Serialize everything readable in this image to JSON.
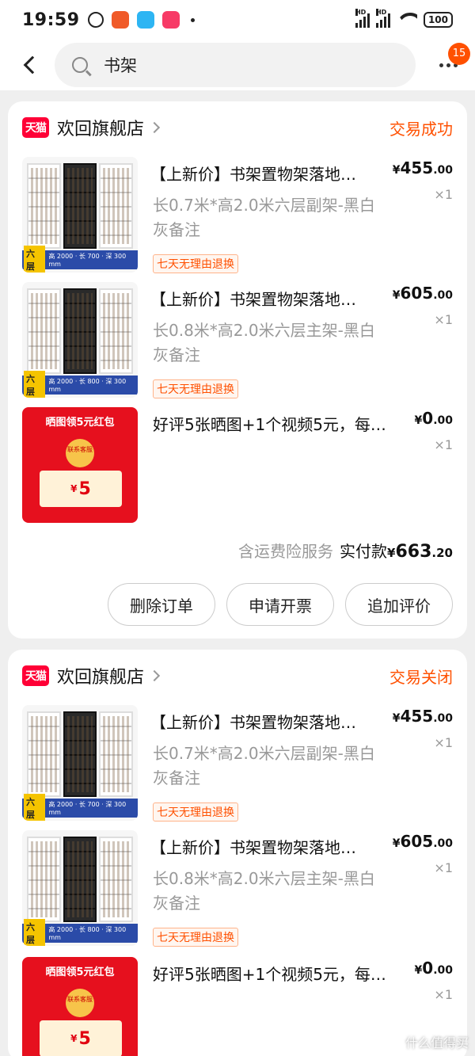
{
  "status_bar": {
    "time": "19:59",
    "battery": "100",
    "signal_label": "HD"
  },
  "nav": {
    "search_text": "书架",
    "message_count": "15"
  },
  "orders": [
    {
      "shop_logo": "天猫",
      "shop_name": "欢回旗舰店",
      "status": "交易成功",
      "items": [
        {
          "title": "【上新价】书架置物架落地…",
          "spec": "长0.7米*高2.0米六层副架-黑白灰备注",
          "tag": "七天无理由退换",
          "price_int": "455",
          "price_dec": ".00",
          "qty": "×1",
          "thumb_level": "六层",
          "thumb_dims": "高 2000 · 长 700 · 深 300 mm"
        },
        {
          "title": "【上新价】书架置物架落地…",
          "spec": "长0.8米*高2.0米六层主架-黑白灰备注",
          "tag": "七天无理由退换",
          "price_int": "605",
          "price_dec": ".00",
          "qty": "×1",
          "thumb_level": "六层",
          "thumb_dims": "高 2000 · 长 800 · 深 300 mm"
        },
        {
          "title": "好评5张晒图+1个视频5元，每…",
          "price_int": "0",
          "price_dec": ".00",
          "qty": "×1",
          "promo_title": "晒图领5元红包",
          "promo_contact": "联系客服",
          "promo_amount": "5"
        }
      ],
      "summary": {
        "shipping_note": "含运费险服务",
        "paid_label": "实付款",
        "paid_int": "663",
        "paid_dec": ".20"
      },
      "actions": [
        "删除订单",
        "申请开票",
        "追加评价"
      ]
    },
    {
      "shop_logo": "天猫",
      "shop_name": "欢回旗舰店",
      "status": "交易关闭",
      "items": [
        {
          "title": "【上新价】书架置物架落地…",
          "spec": "长0.7米*高2.0米六层副架-黑白灰备注",
          "tag": "七天无理由退换",
          "price_int": "455",
          "price_dec": ".00",
          "qty": "×1",
          "thumb_level": "六层",
          "thumb_dims": "高 2000 · 长 700 · 深 300 mm"
        },
        {
          "title": "【上新价】书架置物架落地…",
          "spec": "长0.8米*高2.0米六层主架-黑白灰备注",
          "tag": "七天无理由退换",
          "price_int": "605",
          "price_dec": ".00",
          "qty": "×1",
          "thumb_level": "六层",
          "thumb_dims": "高 2000 · 长 800 · 深 300 mm"
        },
        {
          "title": "好评5张晒图+1个视频5元，每…",
          "price_int": "0",
          "price_dec": ".00",
          "qty": "×1",
          "promo_title": "晒图领5元红包",
          "promo_contact": "联系客服",
          "promo_amount": "5"
        }
      ]
    }
  ],
  "currency_symbol": "¥",
  "watermark": "什么值得买",
  "colors": {
    "accent": "#ff5000",
    "tmall_red": "#ff0036",
    "background": "#efefef"
  }
}
